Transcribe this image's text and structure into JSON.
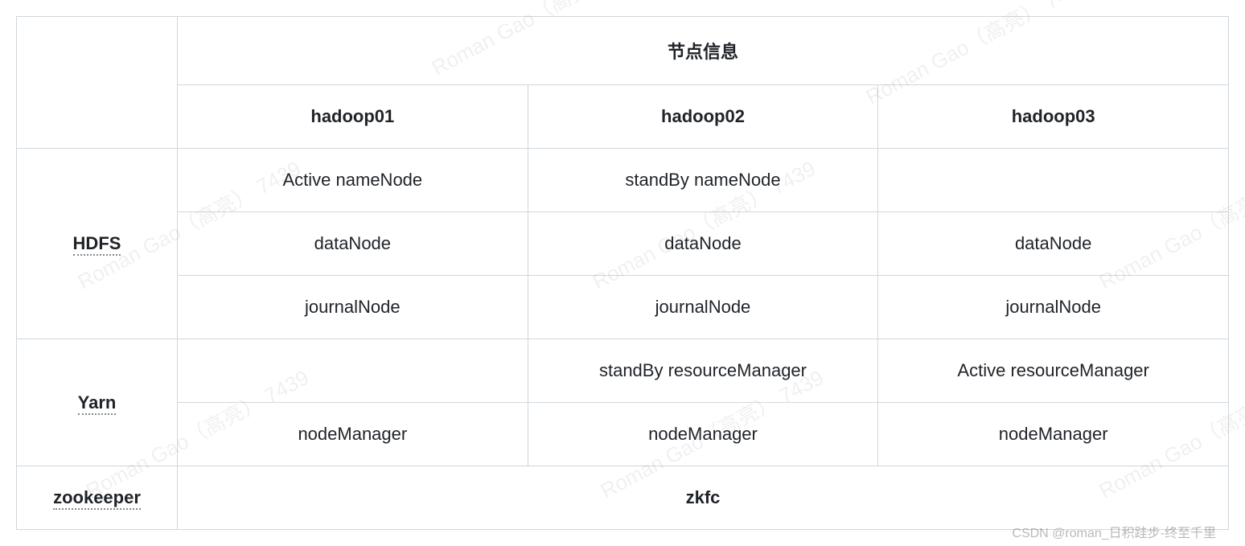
{
  "table": {
    "header_group": "节点信息",
    "columns": [
      "hadoop01",
      "hadoop02",
      "hadoop03"
    ],
    "sections": {
      "hdfs": {
        "label": "HDFS",
        "rows": [
          [
            "Active nameNode",
            "standBy nameNode",
            ""
          ],
          [
            "dataNode",
            "dataNode",
            "dataNode"
          ],
          [
            "journalNode",
            "journalNode",
            "journalNode"
          ]
        ]
      },
      "yarn": {
        "label": "Yarn",
        "rows": [
          [
            "",
            "standBy  resourceManager",
            "Active resourceManager"
          ],
          [
            "nodeManager",
            "nodeManager",
            "nodeManager"
          ]
        ]
      },
      "zookeeper": {
        "label": "zookeeper",
        "merged_value": "zkfc"
      }
    }
  },
  "watermark_text": "Roman Gao（高亮） 7439",
  "attribution": "CSDN @roman_日积跬步-终至千里"
}
